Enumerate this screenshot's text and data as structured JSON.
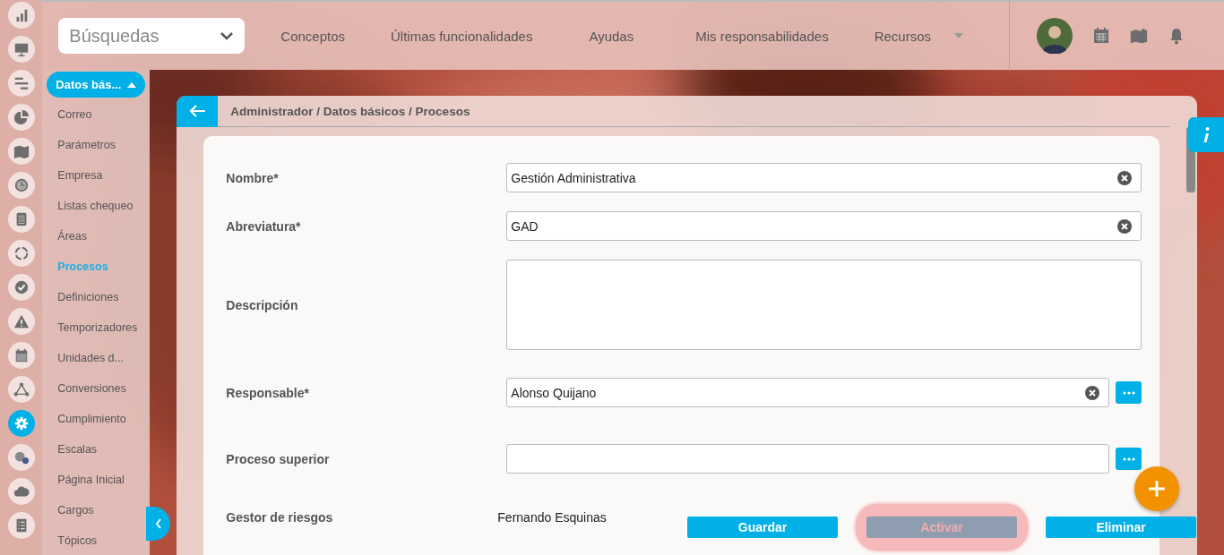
{
  "rail": [
    {
      "selected": false
    },
    {
      "selected": false
    },
    {
      "selected": false
    },
    {
      "selected": false
    },
    {
      "selected": false
    },
    {
      "selected": false
    },
    {
      "selected": false
    },
    {
      "selected": false
    },
    {
      "selected": false
    },
    {
      "selected": false
    },
    {
      "selected": false
    },
    {
      "selected": false
    },
    {
      "selected": true
    },
    {
      "selected": false
    },
    {
      "selected": false
    },
    {
      "selected": false
    }
  ],
  "search": {
    "value": "Búsquedas"
  },
  "nav": [
    {
      "label": "Conceptos",
      "dropdown": false
    },
    {
      "label": "Últimas funcionalidades",
      "dropdown": false
    },
    {
      "label": "Ayudas",
      "dropdown": false
    },
    {
      "label": "Mis responsabilidades",
      "dropdown": false
    },
    {
      "label": "Recursos",
      "dropdown": true
    }
  ],
  "sidebar": {
    "title": "Datos bás...",
    "expanded": true,
    "items": [
      {
        "label": "Correo",
        "selected": false
      },
      {
        "label": "Parámetros",
        "selected": false
      },
      {
        "label": "Empresa",
        "selected": false
      },
      {
        "label": "Listas chequeo",
        "selected": false
      },
      {
        "label": "Áreas",
        "selected": false
      },
      {
        "label": "Procesos",
        "selected": true
      },
      {
        "label": "Definiciones",
        "selected": false
      },
      {
        "label": "Temporizadores",
        "selected": false
      },
      {
        "label": "Unidades d...",
        "selected": false
      },
      {
        "label": "Conversiones",
        "selected": false
      },
      {
        "label": "Cumplimiento",
        "selected": false
      },
      {
        "label": "Escalas",
        "selected": false
      },
      {
        "label": "Página Inicial",
        "selected": false
      },
      {
        "label": "Cargos",
        "selected": false
      },
      {
        "label": "Tópicos",
        "selected": false
      }
    ]
  },
  "breadcrumb": "Administrador / Datos básicos / Procesos",
  "form": [
    {
      "kind": "text",
      "label": "Nombre*",
      "value": "Gestión Administrativa"
    },
    {
      "kind": "text",
      "label": "Abreviatura*",
      "value": "GAD"
    },
    {
      "kind": "textarea",
      "label": "Descripción"
    },
    {
      "kind": "lookup",
      "label": "Responsable*",
      "value": "Alonso Quijano"
    },
    {
      "kind": "lookup",
      "label": "Proceso superior"
    },
    {
      "kind": "readonly",
      "label": "Gestor de riesgos",
      "value": "Fernando Esquinas"
    }
  ],
  "actions": [
    {
      "label": "Guardar",
      "disabled": false,
      "highlighted": false
    },
    {
      "label": "Activar",
      "disabled": true,
      "highlighted": true
    },
    {
      "label": "Eliminar",
      "disabled": false,
      "highlighted": false
    }
  ]
}
